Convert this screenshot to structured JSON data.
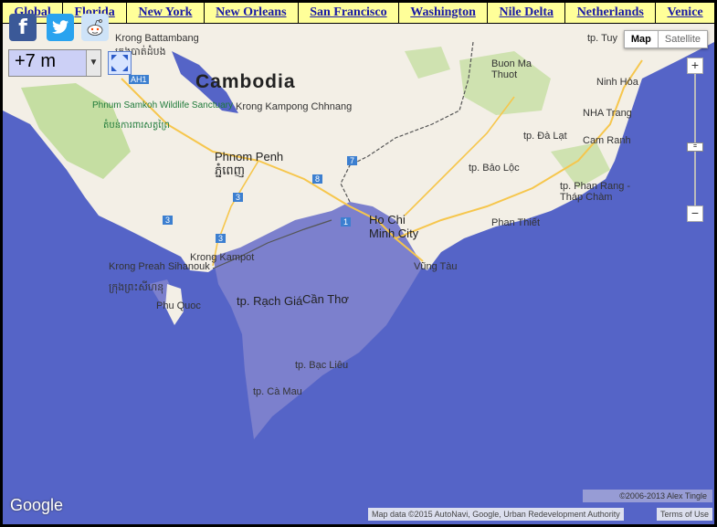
{
  "nav": {
    "links": [
      "Global",
      "Florida",
      "New York",
      "New Orleans",
      "San Francisco",
      "Washington",
      "Nile Delta",
      "Netherlands",
      "Venice"
    ]
  },
  "controls": {
    "sea_level": "+7 m",
    "map_type": {
      "map": "Map",
      "satellite": "Satellite"
    },
    "zoom_in": "+",
    "zoom_out": "−"
  },
  "map_labels": {
    "country": "Cambodia",
    "krong_battambang": "Krong Battambang",
    "krong_battambang_km": "ក្រុងបាត់ដំបង",
    "phnum_samkoh": "Phnum Samkoh Wildlife Sanctuary",
    "phnum_samkoh_km": "តំបន់ការពារសត្វព្រៃ",
    "krong_kampong_chhnang": "Krong Kampong Chhnang",
    "phnom_penh": "Phnom Penh",
    "phnom_penh_km": "ភ្នំពេញ",
    "krong_preah_sihanouk": "Krong Preah Sihanouk",
    "sihanouk_km": "ក្រុងព្រះសីហនុ",
    "krong_kampot": "Krong Kampot",
    "phu_quoc": "Phu Quoc",
    "rach_gia": "tp. Rạch Giá",
    "can_tho": "Cần Thơ",
    "bac_lieu": "tp. Bạc Liêu",
    "ca_mau": "tp. Cà Mau",
    "ho_chi_minh": "Ho Chi Minh City",
    "vung_tau": "Vũng Tàu",
    "phan_thiet": "Phan Thiết",
    "bao_loc": "tp. Bảo Lộc",
    "da_lat": "tp. Đà Lạt",
    "phan_rang": "tp. Phan Rang - Tháp Chàm",
    "cam_ranh": "Cam Ranh",
    "nha_trang": "NHA Trang",
    "ninh_hoa": "Ninh Hòa",
    "buon_ma_thuot": "Buon Ma Thuot",
    "tuy": "tp. Tuy",
    "road_ah1": "AH1",
    "road_3a": "3",
    "road_3b": "3",
    "road_3c": "3",
    "road_7": "7",
    "road_8": "8",
    "road_1": "1"
  },
  "footer": {
    "google": "Google",
    "copyright": "©2006-2013 Alex Tingle",
    "attribution": "Map data ©2015 AutoNavi, Google, Urban Redevelopment Authority",
    "terms": "Terms of Use"
  },
  "colors": {
    "sea": "#5564c7",
    "flood": "#7c80cd",
    "land": "#f3efe6",
    "forest": "#c5dea2",
    "nav_bg": "#ffff99"
  }
}
